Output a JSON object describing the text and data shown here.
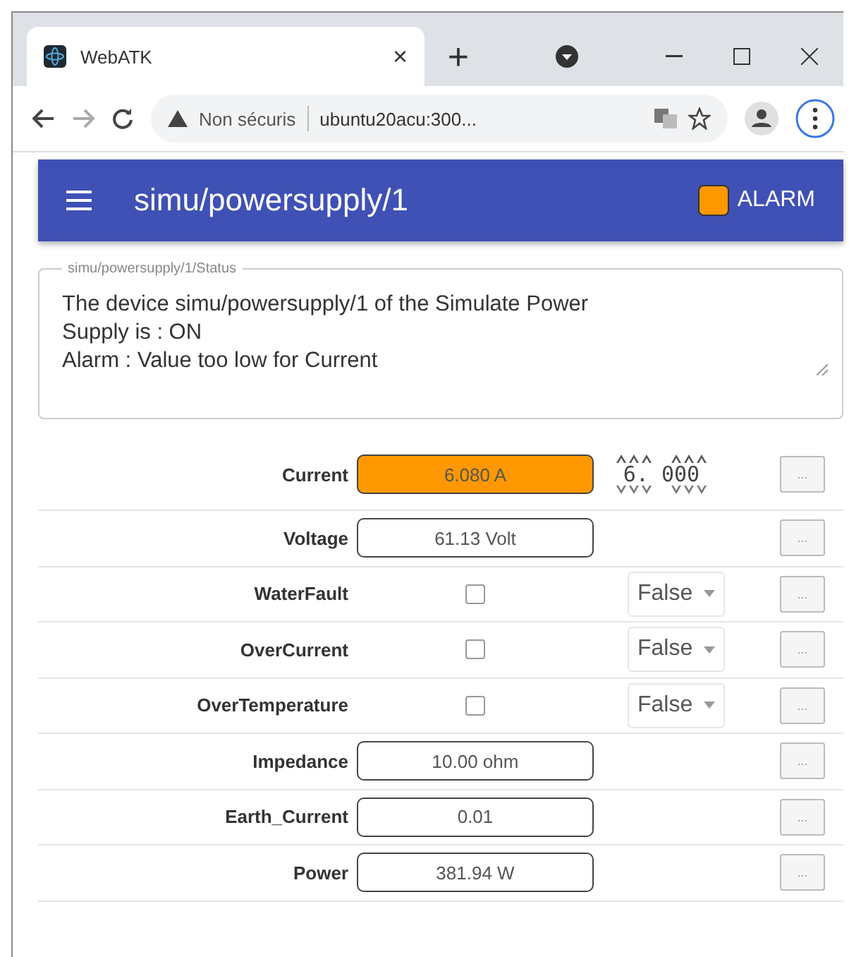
{
  "browser": {
    "tab": {
      "title": "WebATK",
      "close": "×"
    },
    "new_tab": "+",
    "security": "Non sécuris",
    "url": "ubuntu20acu:300..."
  },
  "header": {
    "title": "simu/powersupply/1",
    "alarm_label": "ALARM"
  },
  "status": {
    "legend": "simu/powersupply/1/Status",
    "text": "The device simu/powersupply/1 of the Simulate Power\nSupply is : ON\nAlarm : Value too low for Current"
  },
  "attributes": [
    {
      "kind": "scalar",
      "label": "Current",
      "value": "6.080 A",
      "alarm": true,
      "setter": "6. 000",
      "more": "..."
    },
    {
      "kind": "scalar",
      "label": "Voltage",
      "value": "61.13 Volt",
      "alarm": false,
      "more": "..."
    },
    {
      "kind": "boolean",
      "label": "WaterFault",
      "checked": false,
      "select": "False",
      "more": "..."
    },
    {
      "kind": "boolean",
      "label": "OverCurrent",
      "checked": false,
      "select": "False",
      "more": "..."
    },
    {
      "kind": "boolean",
      "label": "OverTemperature",
      "checked": false,
      "select": "False",
      "more": "..."
    },
    {
      "kind": "scalar",
      "label": "Impedance",
      "value": "10.00 ohm",
      "alarm": false,
      "more": "..."
    },
    {
      "kind": "scalar",
      "label": "Earth_Current",
      "value": "0.01",
      "alarm": false,
      "more": "..."
    },
    {
      "kind": "scalar",
      "label": "Power",
      "value": "381.94 W",
      "alarm": false,
      "more": "..."
    }
  ]
}
